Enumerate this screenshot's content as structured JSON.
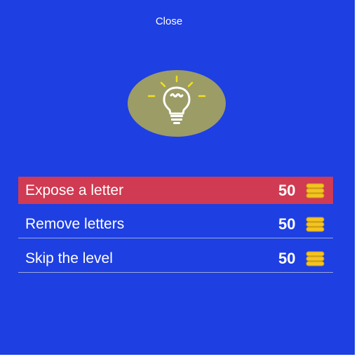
{
  "header": {
    "close_label": "Close"
  },
  "hint_icon": "lightbulb-icon",
  "options": [
    {
      "label": "Expose a letter",
      "price": "50",
      "icon": "coins-icon"
    },
    {
      "label": "Remove letters",
      "price": "50",
      "icon": "coins-icon"
    },
    {
      "label": "Skip the level",
      "price": "50",
      "icon": "coins-icon"
    }
  ],
  "colors": {
    "background": "#1e3fe2",
    "highlight": "#d03a52",
    "bulb_circle": "#9c9c66",
    "coin": "#f3c321"
  }
}
